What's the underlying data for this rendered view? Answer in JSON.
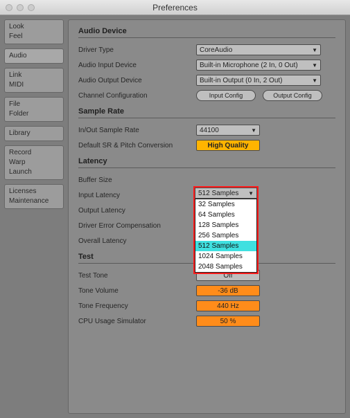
{
  "window": {
    "title": "Preferences"
  },
  "sidebar": {
    "groups": [
      {
        "items": [
          "Look",
          "Feel"
        ],
        "active": false
      },
      {
        "items": [
          "Audio"
        ],
        "active": true
      },
      {
        "items": [
          "Link",
          "MIDI"
        ],
        "active": false
      },
      {
        "items": [
          "File",
          "Folder"
        ],
        "active": false
      },
      {
        "items": [
          "Library"
        ],
        "active": false
      },
      {
        "items": [
          "Record",
          "Warp",
          "Launch"
        ],
        "active": false
      },
      {
        "items": [
          "Licenses",
          "Maintenance"
        ],
        "active": false
      }
    ]
  },
  "sections": {
    "audioDevice": {
      "title": "Audio Device",
      "driverType": {
        "label": "Driver Type",
        "value": "CoreAudio"
      },
      "inputDevice": {
        "label": "Audio Input Device",
        "value": "Built-in Microphone (2 In, 0 Out)"
      },
      "outputDevice": {
        "label": "Audio Output Device",
        "value": "Built-in Output (0 In, 2 Out)"
      },
      "channelConfig": {
        "label": "Channel Configuration",
        "inputBtn": "Input Config",
        "outputBtn": "Output Config"
      }
    },
    "sampleRate": {
      "title": "Sample Rate",
      "ioRate": {
        "label": "In/Out Sample Rate",
        "value": "44100"
      },
      "srPitch": {
        "label": "Default SR & Pitch Conversion",
        "value": "High Quality"
      }
    },
    "latency": {
      "title": "Latency",
      "bufferSize": {
        "label": "Buffer Size",
        "selected": "512 Samples",
        "options": [
          "32 Samples",
          "64 Samples",
          "128 Samples",
          "256 Samples",
          "512 Samples",
          "1024 Samples",
          "2048 Samples"
        ],
        "highlighted": "512 Samples"
      },
      "inputLatency": {
        "label": "Input Latency"
      },
      "outputLatency": {
        "label": "Output Latency"
      },
      "driverError": {
        "label": "Driver Error Compensation"
      },
      "overallLatency": {
        "label": "Overall Latency"
      }
    },
    "test": {
      "title": "Test",
      "testTone": {
        "label": "Test Tone",
        "value": "Off"
      },
      "toneVolume": {
        "label": "Tone Volume",
        "value": "-36 dB"
      },
      "toneFreq": {
        "label": "Tone Frequency",
        "value": "440 Hz"
      },
      "cpuSim": {
        "label": "CPU Usage Simulator",
        "value": "50 %"
      }
    }
  }
}
